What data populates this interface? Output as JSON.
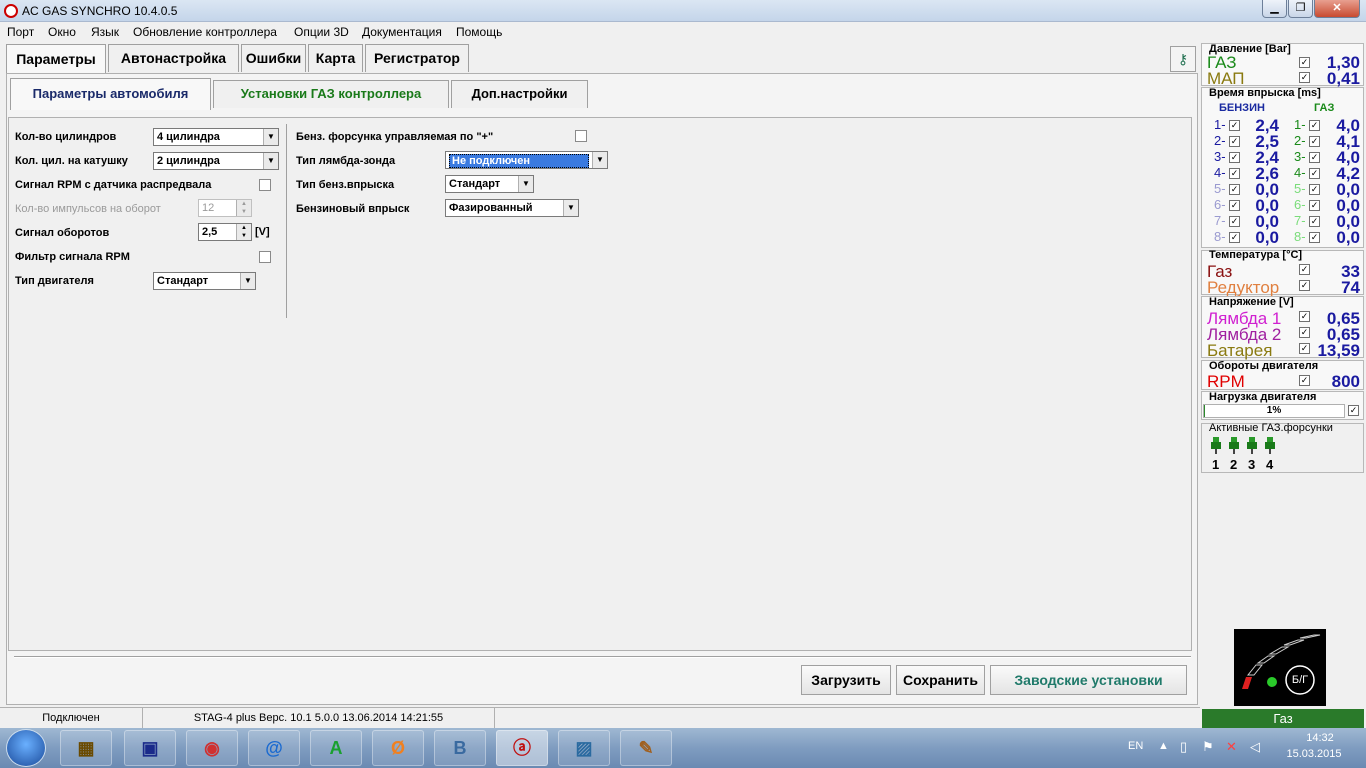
{
  "window": {
    "title": "AC GAS SYNCHRO  10.4.0.5",
    "min": "▁",
    "max": "❐",
    "close": "✕"
  },
  "menu": [
    "Порт",
    "Окно",
    "Язык",
    "Обновление контроллера",
    "Опции 3D",
    "Документация",
    "Помощь"
  ],
  "tabs": [
    "Параметры",
    "Автонастройка",
    "Ошибки",
    "Карта",
    "Регистратор"
  ],
  "subtabs": [
    "Параметры автомобиля",
    "Установки ГАЗ контроллера",
    "Доп.настройки"
  ],
  "form_left": {
    "cyl_label": "Кол-во цилиндров",
    "cyl_value": "4 цилиндра",
    "coil_label": "Кол. цил. на катушку",
    "coil_value": "2 цилиндра",
    "rpm_cam_label": "Сигнал RPM с датчика распредвала",
    "pulses_label": "Кол-во импульсов на оборот",
    "pulses_value": "12",
    "rpm_signal_label": "Сигнал оборотов",
    "rpm_signal_value": "2,5",
    "rpm_signal_unit": "[V]",
    "rpm_filter_label": "Фильтр сигнала RPM",
    "engine_type_label": "Тип двигателя",
    "engine_type_value": "Стандарт"
  },
  "form_right": {
    "injector_plus_label": "Бенз. форсунка управляемая по \"+\"",
    "lambda_label": "Тип лямбда-зонда",
    "lambda_value": "Не подключен",
    "petrol_inj_type_label": "Тип бенз.впрыска",
    "petrol_inj_type_value": "Стандарт",
    "petrol_injection_label": "Бензиновый впрыск",
    "petrol_injection_value": "Фазированный"
  },
  "buttons": {
    "load": "Загрузить",
    "save": "Сохранить",
    "factory": "Заводские установки"
  },
  "panel": {
    "pressure_title": "Давление [Bar]",
    "gas_label": "ГАЗ",
    "gas_value": "1,30",
    "map_label": "МАП",
    "map_value": "0,41",
    "inj_title": "Время впрыска [ms]",
    "petrol_hdr": "БЕНЗИН",
    "gas_hdr": "ГАЗ",
    "petrol": [
      "2,4",
      "2,5",
      "2,4",
      "2,6",
      "0,0",
      "0,0",
      "0,0",
      "0,0"
    ],
    "gas": [
      "4,0",
      "4,1",
      "4,0",
      "4,2",
      "0,0",
      "0,0",
      "0,0",
      "0,0"
    ],
    "temp_title": "Температура  [°C]",
    "temp_gas_label": "Газ",
    "temp_gas_value": "33",
    "temp_red_label": "Редуктор",
    "temp_red_value": "74",
    "volt_title": "Напряжение [V]",
    "lambda1_label": "Лямбда 1",
    "lambda1_value": "0,65",
    "lambda2_label": "Лямбда 2",
    "lambda2_value": "0,65",
    "battery_label": "Батарея",
    "battery_value": "13,59",
    "rpm_title": "Обороты двигателя",
    "rpm_label": "RPM",
    "rpm_value": "800",
    "load_title": "Нагрузка двигателя",
    "load_value": "1%",
    "active_title": "Активные ГАЗ.форсунки",
    "active_nums": [
      "1",
      "2",
      "3",
      "4"
    ],
    "switch_label": "Б/Г",
    "mode": "Газ"
  },
  "status": {
    "connected": "Подключен",
    "device": "STAG-4 plus   Верс. 10.1  5.0.0    13.06.2014 14:21:55"
  },
  "taskbar": {
    "lang": "EN",
    "time": "14:32",
    "date": "15.03.2015"
  },
  "colors": {
    "gas_green": "#1a8a1a",
    "map_olive": "#8a7a10",
    "lambda1": "#d020d0",
    "lambda2": "#a020a0",
    "battery": "#8a7a10",
    "temp_gas": "#8a1010",
    "temp_red": "#e08040",
    "rpm_red": "#e00000",
    "value_blue": "#1a1aa0"
  }
}
